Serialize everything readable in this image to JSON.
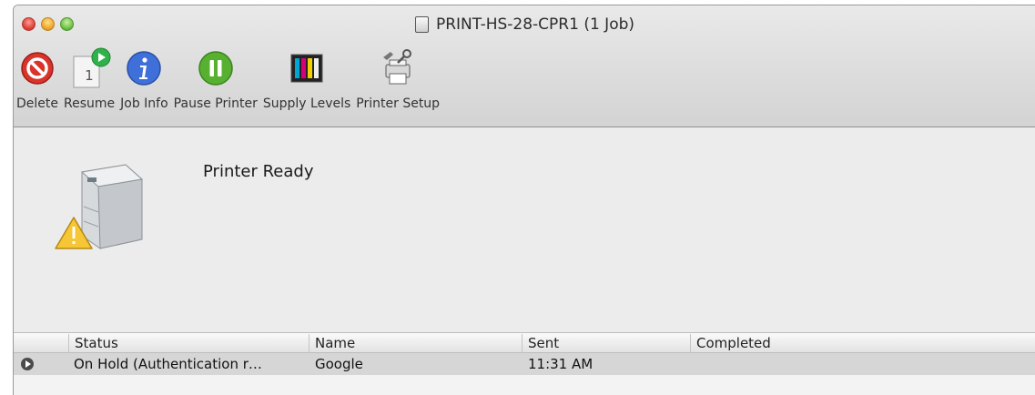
{
  "window": {
    "title": "PRINT-HS-28-CPR1 (1 Job)"
  },
  "toolbar": {
    "delete_label": "Delete",
    "resume_label": "Resume",
    "resume_badge": "1",
    "job_info_label": "Job Info",
    "pause_label": "Pause Printer",
    "supply_label": "Supply Levels",
    "setup_label": "Printer Setup"
  },
  "printer": {
    "status": "Printer Ready"
  },
  "table": {
    "columns": [
      "Status",
      "Name",
      "Sent",
      "Completed"
    ],
    "rows": [
      {
        "status": "On Hold (Authentication r…",
        "name": "Google",
        "sent": "11:31 AM",
        "completed": ""
      }
    ]
  },
  "colors": {
    "delete_red": "#d9342b",
    "info_blue": "#3f6fd8",
    "pause_green": "#58b030",
    "resume_green": "#2fb24a"
  },
  "icons": [
    "delete-icon",
    "resume-icon",
    "job-info-icon",
    "pause-printer-icon",
    "supply-levels-icon",
    "printer-setup-icon",
    "printer-icon",
    "warning-icon",
    "document-icon"
  ]
}
